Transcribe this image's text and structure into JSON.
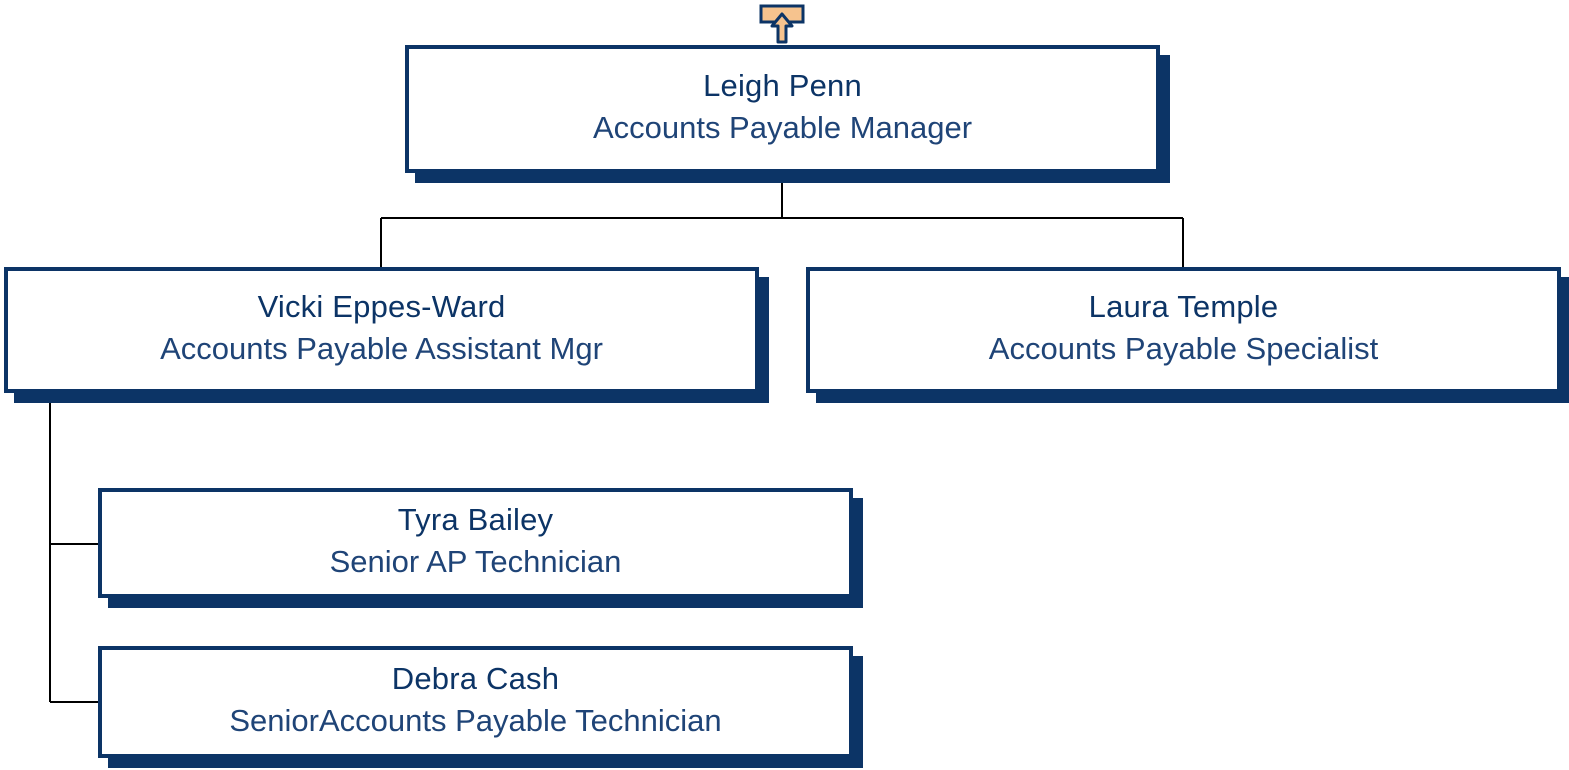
{
  "org_chart": {
    "navigate_up_icon": "arrow-up-icon",
    "colors": {
      "border": "#0c3466",
      "name_text": "#0c3466",
      "title_text": "#1f4477",
      "connector": "#000000",
      "up_button_fill": "#f6c38e",
      "up_button_stroke": "#0c3466"
    },
    "manager": {
      "name": "Leigh Penn",
      "title": "Accounts Payable Manager"
    },
    "direct_reports": [
      {
        "name": "Vicki Eppes-Ward",
        "title": "Accounts Payable Assistant Mgr"
      },
      {
        "name": "Laura Temple",
        "title": "Accounts Payable Specialist"
      }
    ],
    "sub_reports": [
      {
        "name": "Tyra Bailey",
        "title": "Senior AP Technician"
      },
      {
        "name": "Debra Cash",
        "title": "SeniorAccounts Payable Technician"
      }
    ]
  }
}
